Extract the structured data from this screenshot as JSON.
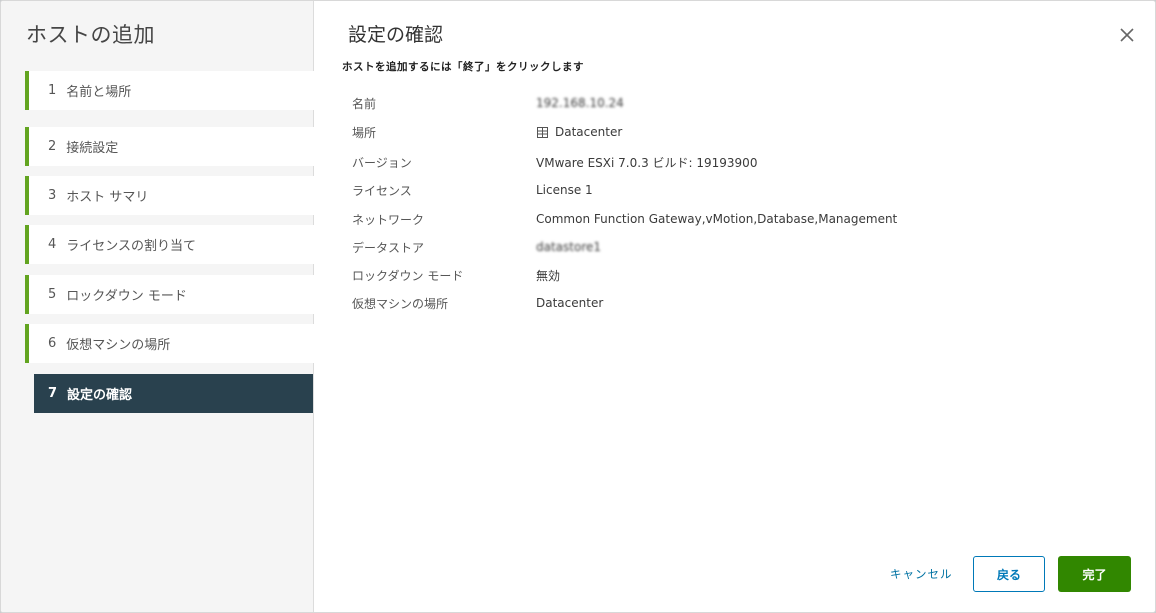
{
  "wizard": {
    "title": "ホストの追加",
    "steps": [
      {
        "num": "1",
        "label": "名前と場所"
      },
      {
        "num": "2",
        "label": "接続設定"
      },
      {
        "num": "3",
        "label": "ホスト サマリ"
      },
      {
        "num": "4",
        "label": "ライセンスの割り当て"
      },
      {
        "num": "5",
        "label": "ロックダウン モード"
      },
      {
        "num": "6",
        "label": "仮想マシンの場所"
      },
      {
        "num": "7",
        "label": "設定の確認"
      }
    ],
    "active_step": 7,
    "accent_color": "#62a420",
    "active_bg_color": "#29414e"
  },
  "page": {
    "title": "設定の確認",
    "subtitle": "ホストを追加するには「終了」をクリックします"
  },
  "summary": [
    {
      "key": "名前",
      "value": "192.168.10.24",
      "redacted": true
    },
    {
      "key": "場所",
      "value": "Datacenter",
      "icon": "datacenter-icon"
    },
    {
      "key": "バージョン",
      "value": "VMware ESXi 7.0.3 ビルド: 19193900"
    },
    {
      "key": "ライセンス",
      "value": "License 1"
    },
    {
      "key": "ネットワーク",
      "value": "Common Function Gateway,vMotion,Database,Management"
    },
    {
      "key": "データストア",
      "value": "datastore1",
      "redacted": true
    },
    {
      "key": "ロックダウン モード",
      "value": "無効"
    },
    {
      "key": "仮想マシンの場所",
      "value": "Datacenter"
    }
  ],
  "footer": {
    "cancel_label": "キャンセル",
    "back_label": "戻る",
    "finish_label": "完了",
    "link_color": "#0072a3",
    "finish_color": "#318700"
  },
  "icons": {
    "close": "close-icon",
    "location": "datacenter-icon"
  }
}
